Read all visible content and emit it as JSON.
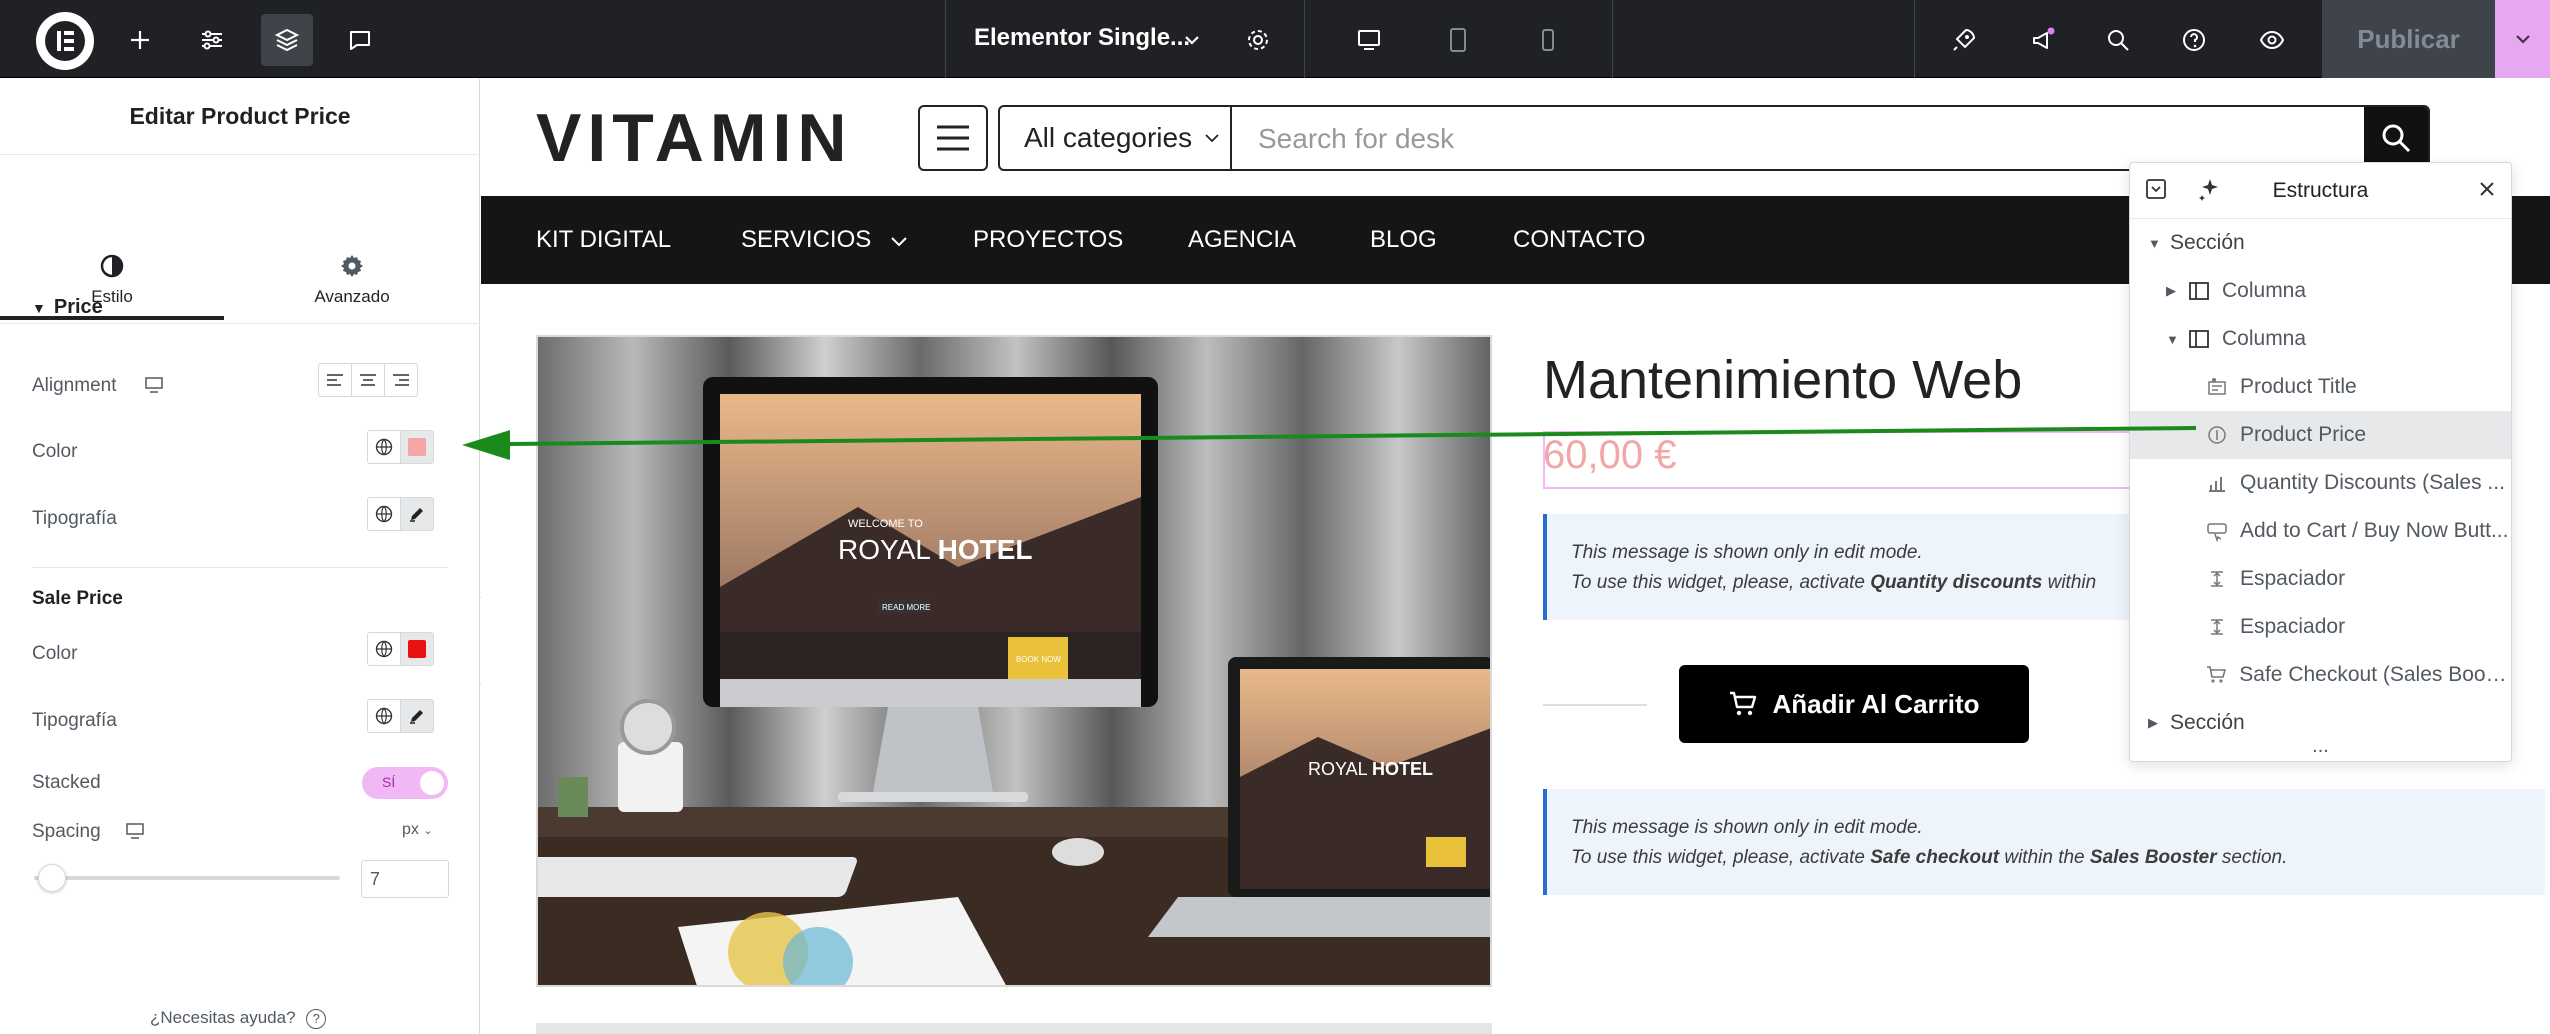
{
  "topbar": {
    "document_title": "Elementor Single...",
    "publish_label": "Publicar"
  },
  "panel": {
    "title": "Editar Product Price",
    "tabs": [
      {
        "label": "Estilo",
        "icon": "half-circle-icon"
      },
      {
        "label": "Avanzado",
        "icon": "gear-icon"
      }
    ],
    "price_section": {
      "heading": "Price",
      "alignment_label": "Alignment",
      "color_label": "Color",
      "color_value": "#f2a6a6",
      "typography_label": "Tipografía"
    },
    "sale_section": {
      "heading": "Sale Price",
      "color_label": "Color",
      "color_value": "#e81212",
      "typography_label": "Tipografía",
      "stacked_label": "Stacked",
      "stacked_toggle": "SÍ",
      "spacing_label": "Spacing",
      "spacing_unit": "px",
      "spacing_value": "7"
    },
    "help_text": "¿Necesitas ayuda?"
  },
  "site": {
    "brand": "VITAMIN",
    "category_select": "All categories",
    "search_placeholder": "Search for desk",
    "nav": [
      "KIT DIGITAL",
      "SERVICIOS",
      "PROYECTOS",
      "AGENCIA",
      "BLOG",
      "CONTACTO"
    ],
    "product_title": "Mantenimiento Web",
    "price": "60,00 €",
    "notice1": {
      "line1": "This message is shown only in edit mode.",
      "line2_pre": "To use this widget, please, activate ",
      "line2_bold": "Quantity discounts",
      "line2_post": " within"
    },
    "cart_button": "Añadir Al Carrito",
    "notice2": {
      "line1": "This message is shown only in edit mode.",
      "line2_pre": "To use this widget, please, activate ",
      "line2_bold1": "Safe checkout",
      "line2_mid": " within the ",
      "line2_bold2": "Sales Booster",
      "line2_post": " section."
    },
    "image_text": {
      "hotel_welcome": "WELCOME TO",
      "hotel_name_a": "ROYAL ",
      "hotel_name_b": "HOTEL",
      "read_more": "READ MORE",
      "book_now": "BOOK NOW"
    }
  },
  "structure": {
    "title": "Estructura",
    "rows": [
      {
        "label": "Sección",
        "level": 0,
        "caret": "down",
        "icon": ""
      },
      {
        "label": "Columna",
        "level": 1,
        "caret": "right",
        "icon": "column-icon"
      },
      {
        "label": "Columna",
        "level": 1,
        "caret": "down",
        "icon": "column-icon"
      },
      {
        "label": "Product Title",
        "level": 2,
        "caret": "",
        "icon": "product-title-icon"
      },
      {
        "label": "Product Price",
        "level": 2,
        "caret": "",
        "icon": "product-price-icon"
      },
      {
        "label": "Quantity Discounts (Sales ...",
        "level": 2,
        "caret": "",
        "icon": "chart-icon"
      },
      {
        "label": "Add to Cart / Buy Now Butt...",
        "level": 2,
        "caret": "",
        "icon": "add-to-cart-icon"
      },
      {
        "label": "Espaciador",
        "level": 2,
        "caret": "",
        "icon": "spacer-icon"
      },
      {
        "label": "Espaciador",
        "level": 2,
        "caret": "",
        "icon": "spacer-icon"
      },
      {
        "label": "Safe Checkout (Sales Boos...",
        "level": 2,
        "caret": "",
        "icon": "cart-icon"
      },
      {
        "label": "Sección",
        "level": 0,
        "caret": "right",
        "icon": ""
      }
    ],
    "more": "..."
  },
  "colors": {
    "annotation_arrow": "#1a8a1a",
    "accent_pink": "#f0b9f5",
    "topbar_bg": "#1f2124"
  }
}
